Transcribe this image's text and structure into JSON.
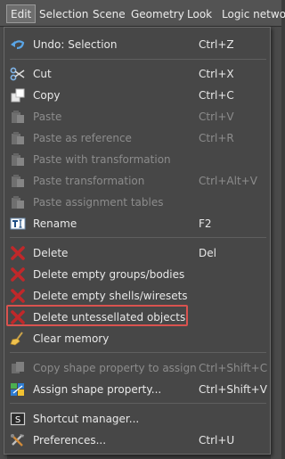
{
  "menubar": {
    "items": [
      "Edit",
      "Selection",
      "Scene",
      "Geometry",
      "Look",
      "Logic network"
    ]
  },
  "menu": {
    "undo": {
      "label": "Undo: Selection",
      "shortcut": "Ctrl+Z",
      "icon": "undo-icon"
    },
    "cut": {
      "label": "Cut",
      "shortcut": "Ctrl+X",
      "icon": "scissors-icon"
    },
    "copy": {
      "label": "Copy",
      "shortcut": "Ctrl+C",
      "icon": "copy-icon"
    },
    "paste": {
      "label": "Paste",
      "shortcut": "Ctrl+V",
      "icon": "paste-icon"
    },
    "paste_reference": {
      "label": "Paste as reference",
      "shortcut": "Ctrl+R",
      "icon": "paste-icon"
    },
    "paste_with_transform": {
      "label": "Paste with transformation",
      "shortcut": "",
      "icon": "paste-icon"
    },
    "paste_transform": {
      "label": "Paste transformation",
      "shortcut": "Ctrl+Alt+V",
      "icon": "paste-icon"
    },
    "paste_assignment": {
      "label": "Paste assignment tables",
      "shortcut": "",
      "icon": "paste-icon"
    },
    "rename": {
      "label": "Rename",
      "shortcut": "F2",
      "icon": "rename-icon"
    },
    "delete": {
      "label": "Delete",
      "shortcut": "Del",
      "icon": "delete-x-icon"
    },
    "delete_empty_groups": {
      "label": "Delete empty groups/bodies",
      "shortcut": "",
      "icon": "delete-x-icon"
    },
    "delete_empty_shells": {
      "label": "Delete empty shells/wiresets",
      "shortcut": "",
      "icon": "delete-x-icon"
    },
    "delete_untessellated": {
      "label": "Delete untessellated objects",
      "shortcut": "",
      "icon": "delete-x-icon"
    },
    "clear_memory": {
      "label": "Clear memory",
      "shortcut": "",
      "icon": "broom-icon"
    },
    "copy_shape_property": {
      "label": "Copy shape property to assign",
      "shortcut": "Ctrl+Shift+C",
      "icon": "shape-property-icon"
    },
    "assign_shape_property": {
      "label": "Assign shape property...",
      "shortcut": "Ctrl+Shift+V",
      "icon": "assign-shape-icon"
    },
    "shortcut_manager": {
      "label": "Shortcut manager...",
      "shortcut": "",
      "icon": "shortcut-icon"
    },
    "preferences": {
      "label": "Preferences...",
      "shortcut": "Ctrl+U",
      "icon": "tools-icon"
    }
  },
  "colors": {
    "highlight_border": "#d9534f",
    "delete_red": "#c0282a"
  }
}
